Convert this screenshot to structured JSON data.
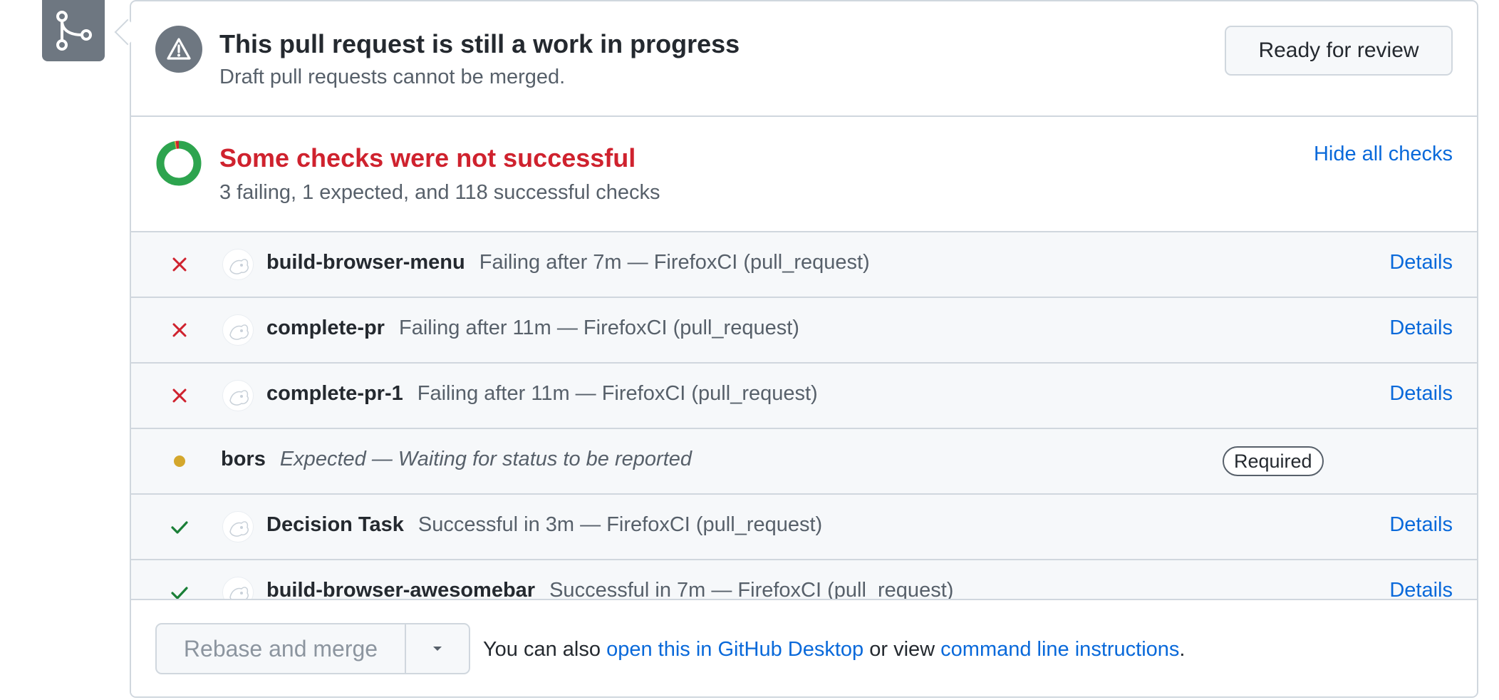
{
  "draft": {
    "title": "This pull request is still a work in progress",
    "subtitle": "Draft pull requests cannot be merged.",
    "ready_button": "Ready for review"
  },
  "checks_summary": {
    "title": "Some checks were not successful",
    "subtitle": "3 failing, 1 expected, and 118 successful checks",
    "hide_link": "Hide all checks",
    "failing": 3,
    "expected": 1,
    "successful": 118
  },
  "checks": [
    {
      "status": "failing",
      "name": "build-browser-menu",
      "description": "Failing after 7m — FirefoxCI (pull_request)",
      "details": "Details"
    },
    {
      "status": "failing",
      "name": "complete-pr",
      "description": "Failing after 11m — FirefoxCI (pull_request)",
      "details": "Details"
    },
    {
      "status": "failing",
      "name": "complete-pr-1",
      "description": "Failing after 11m — FirefoxCI (pull_request)",
      "details": "Details"
    },
    {
      "status": "expected",
      "name": "bors",
      "description": "Expected — Waiting for status to be reported",
      "badge": "Required"
    },
    {
      "status": "success",
      "name": "Decision Task",
      "description": "Successful in 3m — FirefoxCI (pull_request)",
      "details": "Details"
    },
    {
      "status": "success",
      "name": "build-browser-awesomebar",
      "description": "Successful in 7m — FirefoxCI (pull_request)",
      "details": "Details"
    }
  ],
  "merge": {
    "button_label": "Rebase and merge",
    "text_before": "You can also ",
    "desktop_link": "open this in GitHub Desktop",
    "text_middle": " or view ",
    "cli_link": "command line instructions",
    "text_after": "."
  },
  "colors": {
    "fail": "#cf222e",
    "success": "#1a7f37",
    "expected": "#d4a72c",
    "link": "#0969da",
    "ring_success": "#2da44e"
  },
  "icons": {
    "merge_badge": "git-merge-icon",
    "draft_status": "alert-icon",
    "failing": "x-icon",
    "success": "check-icon",
    "expected": "dot-icon"
  }
}
